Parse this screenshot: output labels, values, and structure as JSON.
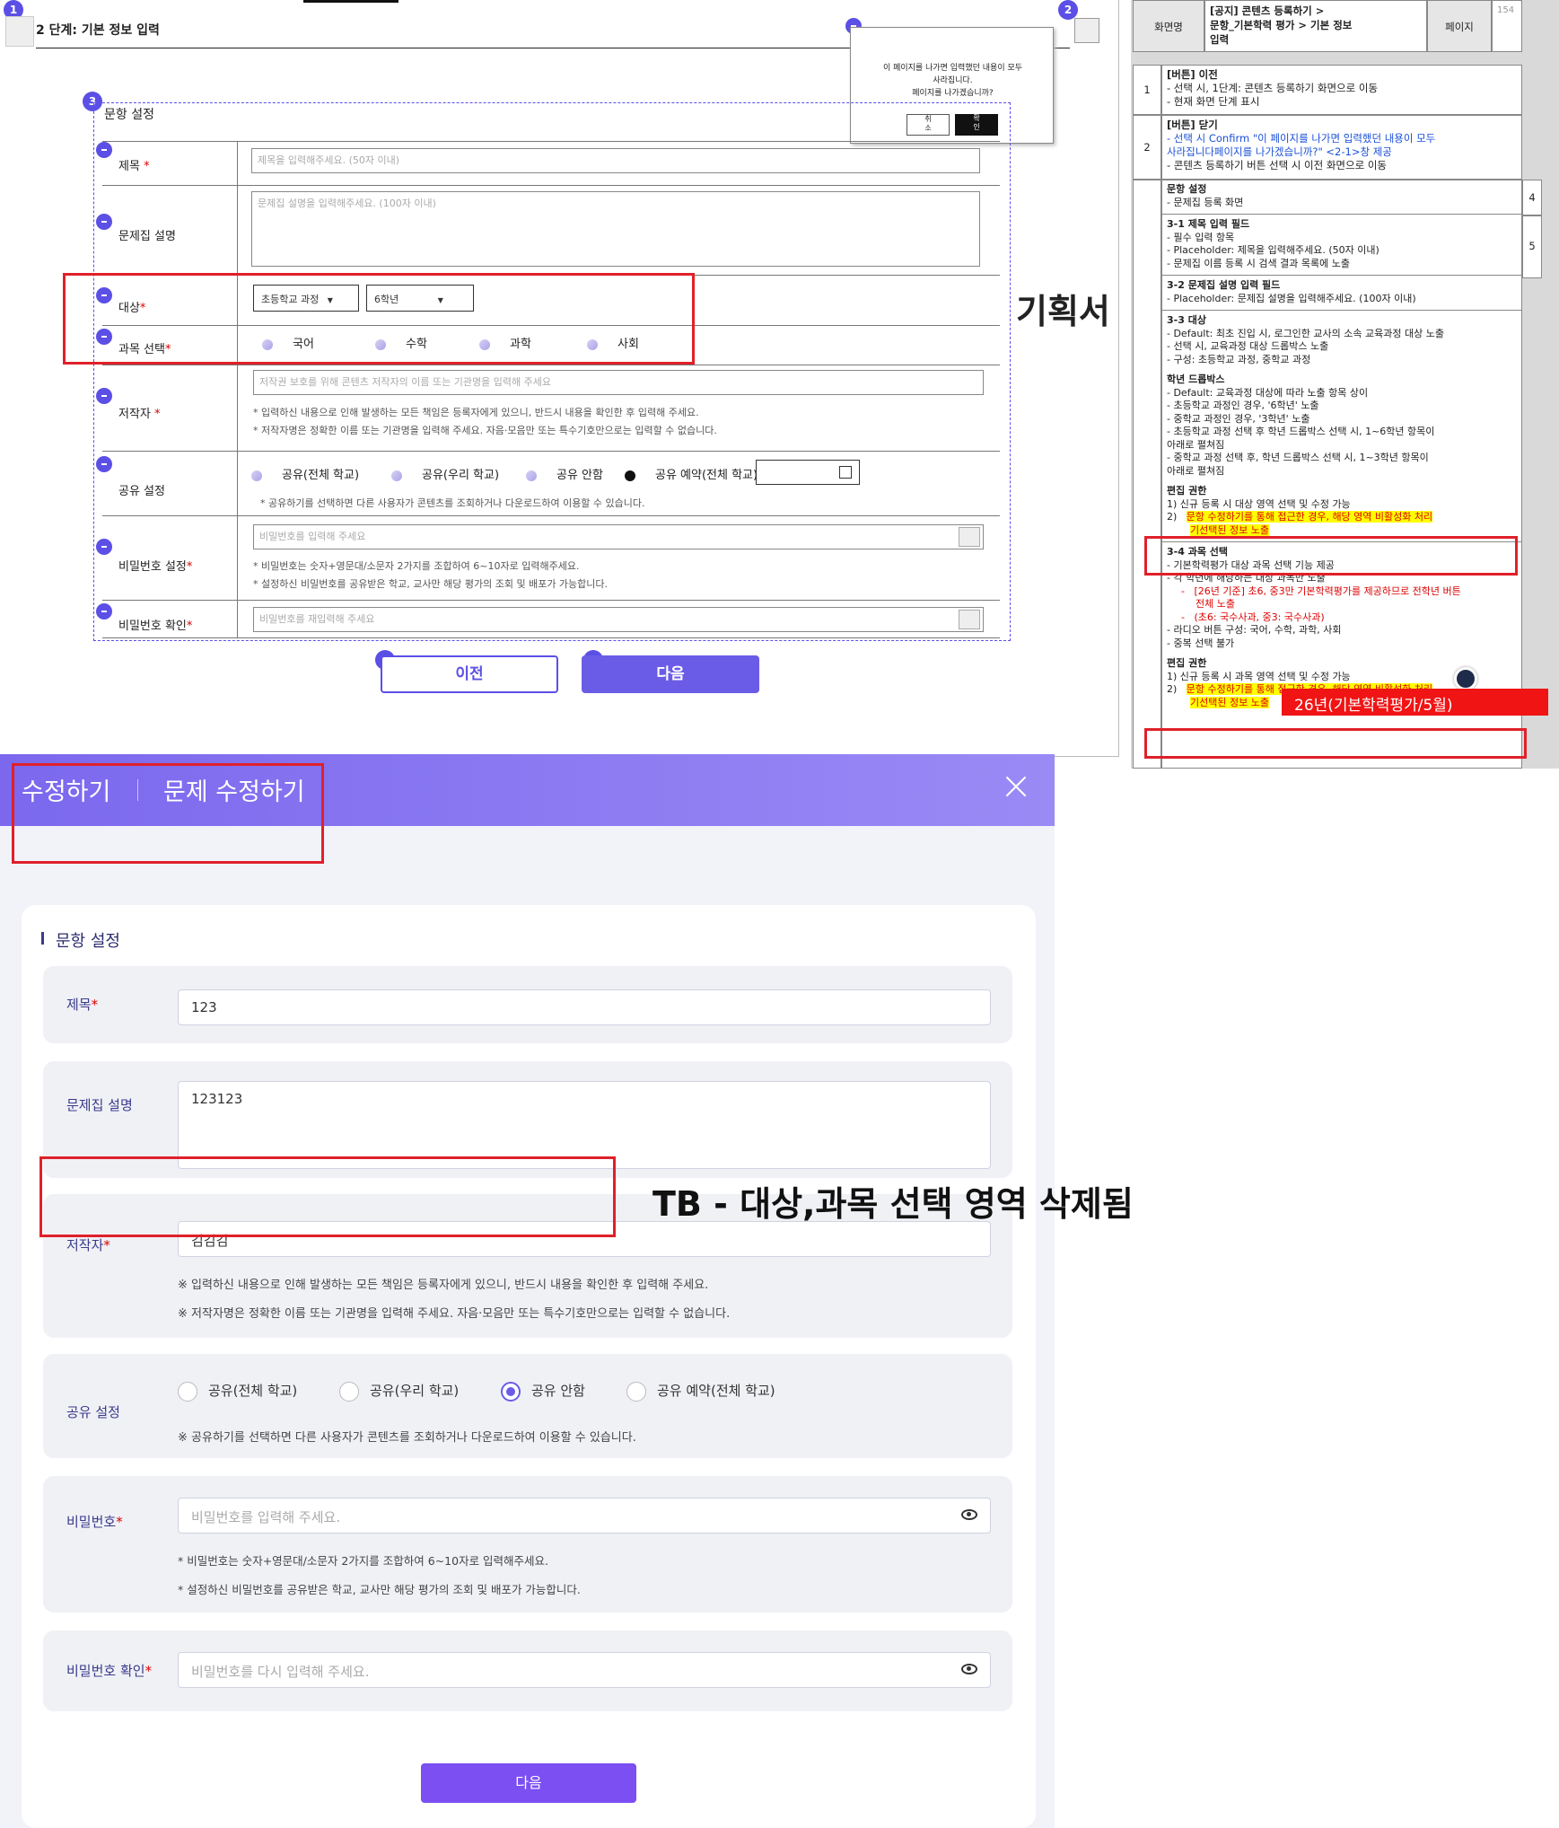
{
  "wireframe": {
    "step_title": "2 단계: 기본 정보 입력",
    "badges": [
      "1",
      "2",
      "3",
      "4",
      "5"
    ],
    "dialog": {
      "line1": "이 페이지를 나가면 입력했던 내용이 모두",
      "line2": "사라집니다.",
      "line3": "페이지를 나가겠습니까?",
      "cancel": "취\n소",
      "confirm": "확\n인"
    },
    "section_title": "문항 설정",
    "fields": {
      "title_label": "제목",
      "title_ph": "제목을 입력해주세요. (50자 이내)",
      "desc_label": "문제집 설명",
      "desc_ph": "문제집 설명을 입력해주세요. (100자 이내)",
      "target_label": "대상",
      "target_select": "초등학교 과정",
      "grade_select": "6학년",
      "subject_label": "과목 선택",
      "subjects": [
        "국어",
        "수학",
        "과학",
        "사회"
      ],
      "author_label": "저작자",
      "author_ph": "저작권 보호를 위해 콘텐츠 저작자의 이름 또는 기관명을 입력해 주세요",
      "author_note1": "* 입력하신 내용으로 인해 발생하는 모든 책임은 등록자에게 있으니, 반드시 내용을 확인한 후 입력해 주세요.",
      "author_note2": "* 저작자명은 정확한 이름 또는 기관명을 입력해 주세요. 자음·모음만 또는 특수기호만으로는 입력할 수 없습니다.",
      "share_label": "공유 설정",
      "share_opts": [
        "공유(전체 학교)",
        "공유(우리 학교)",
        "공유 안함",
        "공유 예약(전체 학교)"
      ],
      "share_note": "* 공유하기를 선택하면 다른 사용자가 콘텐츠를 조회하거나 다운로드하여 이용할 수 있습니다.",
      "pw_label": "비밀번호 설정",
      "pw_ph": "비밀번호를 입력해 주세요",
      "pw_note1": "* 비밀번호는 숫자+영문대/소문자 2가지를 조합하여 6~10자로 입력해주세요.",
      "pw_note2": "* 설정하신 비밀번호를 공유받은 학교, 교사만 해당 평가의 조회 및 배포가 가능합니다.",
      "pwc_label": "비밀번호 확인",
      "pwc_ph": "비밀번호를 재입력해 주세요"
    },
    "prev_button": "이전",
    "next_button": "다음",
    "side_label": "기획서"
  },
  "spec": {
    "header_path": "[공지] 콘텐츠 등록하기 >\n문항_기본학력 평가 > 기본 정보\n입력",
    "header_screen": "화면명",
    "header_page": "페이지",
    "page_no": "154",
    "rows": [
      {
        "no": "1",
        "title": "[버튼] 이전",
        "lines": [
          "-   선택 시, 1단계: 콘텐츠 등록하기 화면으로 이동",
          "-   현재 화면 단계 표시"
        ]
      },
      {
        "no": "2",
        "title": "[버튼] 닫기",
        "lines": [
          "-   선택 시 Confirm \"이 페이지를 나가면 입력했던 내용이 모두",
          "    사라집니다페이지를 나가겠습니까?\" <2-1>창 제공",
          "-   콘텐츠 등록하기 버튼 선택 시 이전 화면으로 이동"
        ]
      }
    ],
    "sec_title": "문항 설정",
    "sec_line": "-   문제집 등록 화면",
    "s31_title": "3-1 제목 입력 필드",
    "s31_lines": [
      "-   필수 입력 항목",
      "-   Placeholder: 제목을 입력해주세요. (50자 이내)",
      "-   문제집 이름 등록 시 검색 결과 목록에 노출"
    ],
    "s32_title": "3-2 문제집 설명 입력 필드",
    "s32_lines": [
      "-   Placeholder: 문제집 설명을 입력해주세요. (100자 이내)"
    ],
    "s33_title": "3-3 대상",
    "s33_lines": [
      "-   Default: 최초 진입 시, 로그인한 교사의 소속 교육과정 대상 노출",
      "-   선택 시, 교육과정 대상 드롭박스 노출",
      "     -   구성: 초등학교 과정, 중학교 과정"
    ],
    "grade_title": "학년 드롭박스",
    "grade_lines": [
      "-   Default: 교육과정 대상에 따라 노출 항목 상이",
      "     -   초등학교 과정인 경우, '6학년' 노출",
      "     -   중학교 과정인 경우, '3학년' 노출",
      "-   초등학교 과정 선택 후 학년 드롭박스 선택 시, 1~6학년 항목이",
      "    아래로 펼쳐짐",
      "-   중학교 과정 선택 후, 학년 드롭박스 선택 시, 1~3학년 항목이",
      "    아래로 펼쳐짐"
    ],
    "edit_title": "편집 권한",
    "edit_line1": "1)   신규 등록 시 대상 영역 선택 및 수정 가능",
    "edit_line2a": "문항 수정하기를 통해 접근한 경우, 해당 영역 비활성화 처리",
    "edit_line2b": "기선택된 정보 노출",
    "s34_title": "3-4 과목 선택",
    "s34_lines": [
      "-   기본학력평가 대상 과목 선택 기능 제공",
      "-   각 학년에 해당하는 대상 과목만 노출"
    ],
    "s34_red1": "[26년 기준] 초6, 중3만 기본학력평가를 제공하므로 전학년 버튼",
    "s34_red1b": "전체 노출",
    "s34_red2": "(초6: 국수사과, 중3: 국수사과)",
    "s34_lines2": [
      "-   라디오 버튼 구성: 국어, 수학, 과학, 사회",
      "-   중복 선택 불가"
    ],
    "edit2_title": "편집 권한",
    "edit2_line1": "1)   신규 등록 시 과목 영역 선택 및 수정 가능",
    "red_tag": "26년(기본학력평가/5월)",
    "right_nums": [
      "4",
      "5"
    ]
  },
  "modal": {
    "tab1": "수정하기",
    "tab2": "문제 수정하기",
    "section_title": "문항 설정",
    "title_label": "제목",
    "title_value": "123",
    "desc_label": "문제집 설명",
    "desc_value": "123123",
    "author_label": "저작자",
    "author_value": "김김김",
    "author_note1": "※ 입력하신 내용으로 인해 발생하는 모든 책임은 등록자에게 있으니, 반드시 내용을 확인한 후 입력해 주세요.",
    "author_note2": "※ 저작자명은 정확한 이름 또는 기관명을 입력해 주세요. 자음·모음만 또는 특수기호만으로는 입력할 수 없습니다.",
    "share_label": "공유 설정",
    "share_opts": [
      "공유(전체 학교)",
      "공유(우리 학교)",
      "공유 안함",
      "공유 예약(전체 학교)"
    ],
    "share_note": "※ 공유하기를 선택하면 다른 사용자가 콘텐츠를 조회하거나 다운로드하여 이용할 수 있습니다.",
    "pw_label": "비밀번호",
    "pw_ph": "비밀번호를 입력해 주세요.",
    "pw_note1": "* 비밀번호는 숫자+영문대/소문자 2가지를 조합하여 6~10자로 입력해주세요.",
    "pw_note2": "* 설정하신 비밀번호를 공유받은 학교, 교사만 해당 평가의 조회 및 배포가 가능합니다.",
    "pwc_label": "비밀번호 확인",
    "pwc_ph": "비밀번호를 다시 입력해 주세요.",
    "next_button": "다음"
  },
  "annotation": "TB - 대상,과목 선택 영역 삭제됨",
  "colors": {
    "accent": "#6b5ce7",
    "highlight_red": "#e0202a",
    "header_gradient": "#7b68ee"
  }
}
